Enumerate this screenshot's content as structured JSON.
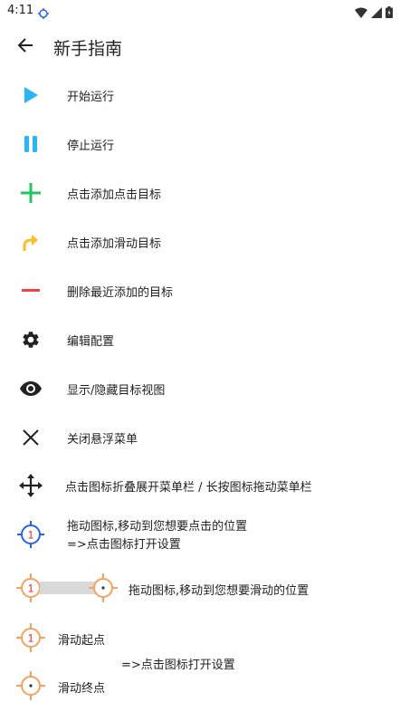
{
  "status": {
    "time": "4:11"
  },
  "app_bar": {
    "title": "新手指南",
    "back_icon": "arrow-left-icon"
  },
  "items": [
    {
      "icon": "play-icon",
      "color": "#29b6f6",
      "label": "开始运行"
    },
    {
      "icon": "pause-icon",
      "color": "#29b6f6",
      "label": "停止运行"
    },
    {
      "icon": "plus-icon",
      "color": "#22c55e",
      "label": "点击添加点击目标"
    },
    {
      "icon": "swipe-arrow-icon",
      "color": "#fbbf24",
      "label": "点击添加滑动目标"
    },
    {
      "icon": "minus-icon",
      "color": "#ef4444",
      "label": "删除最近添加的目标"
    },
    {
      "icon": "gear-icon",
      "color": "#222222",
      "label": "编辑配置"
    },
    {
      "icon": "eye-icon",
      "color": "#222222",
      "label": "显示/隐藏目标视图"
    },
    {
      "icon": "close-icon",
      "color": "#222222",
      "label": "关闭悬浮菜单"
    },
    {
      "icon": "move-icon",
      "color": "#222222",
      "label": "点击图标折叠展开菜单栏 / 长按图标拖动菜单栏"
    }
  ],
  "click_target": {
    "icon": "crosshair-blue-icon",
    "color": "#2563eb",
    "number": "1",
    "line1": "拖动图标,移动到您想要点击的位置",
    "line2": "=>点击图标打开设置"
  },
  "swipe_target": {
    "color": "#f4a261",
    "number": "1",
    "label": "拖动图标,移动到您想要滑动的位置"
  },
  "swipe_points": {
    "start_number": "1",
    "start_label": "滑动起点",
    "settings_hint": "=>点击图标打开设置",
    "end_label": "滑动终点"
  }
}
